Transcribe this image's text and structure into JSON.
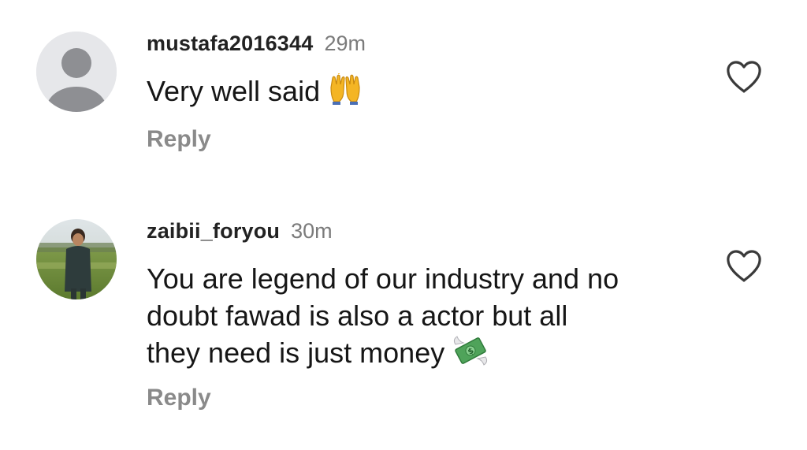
{
  "comments": [
    {
      "username": "mustafa2016344",
      "time": "29m",
      "text": "Very well said",
      "emoji": "raised-hands-icon",
      "reply_label": "Reply"
    },
    {
      "username": "zaibii_foryou",
      "time": "30m",
      "text_lines": [
        "You are legend of our industry and no",
        "doubt fawad is also a actor but all",
        "they need is just money"
      ],
      "emoji": "money-with-wings-icon",
      "reply_label": "Reply"
    }
  ],
  "colors": {
    "username": "#222222",
    "timestamp": "#7b7b7b",
    "reply": "#8a8a8a",
    "default_avatar_bg": "#e6e7ea",
    "default_avatar_fg": "#8e8f93"
  }
}
